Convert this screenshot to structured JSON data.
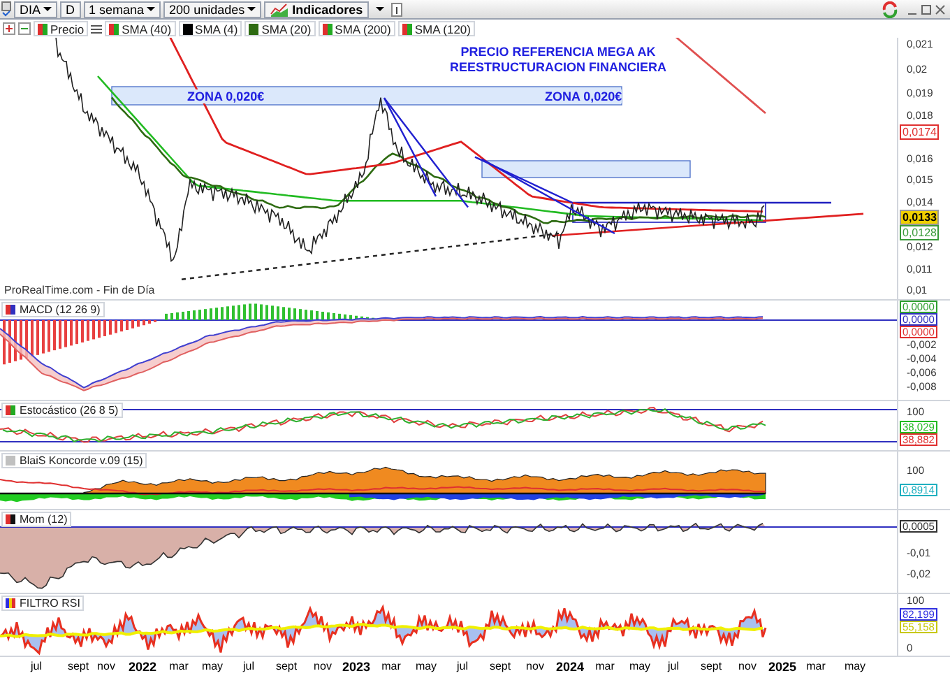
{
  "toolbar": {
    "symbol": "DIA",
    "mode": "D",
    "period": "1 semana",
    "units": "200 unidades",
    "indicators": "Indicadores"
  },
  "legend": [
    {
      "label": "Precio",
      "kind": "split"
    },
    {
      "label": "SMA (40)",
      "kind": "split"
    },
    {
      "label": "SMA (4)",
      "kind": "solid",
      "color": "#000000"
    },
    {
      "label": "SMA (20)",
      "kind": "solid",
      "color": "#2e6b12"
    },
    {
      "label": "SMA (200)",
      "kind": "split"
    },
    {
      "label": "SMA (120)",
      "kind": "split"
    }
  ],
  "main_chart": {
    "title_lines": [
      "PRECIO REFERENCIA MEGA AK",
      "REESTRUCTURACION FINANCIERA"
    ],
    "zone_labels": [
      "ZONA 0,020€",
      "ZONA 0,020€"
    ],
    "source": "ProRealTime.com - Fin de Día",
    "ticks": [
      "0,021",
      "0,02",
      "0,019",
      "0,018",
      "0,016",
      "0,015",
      "0,014",
      "0,012",
      "0,011",
      "0,01"
    ],
    "badges": [
      {
        "text": "0,0174",
        "color": "#e03030"
      },
      {
        "text": "0,0133",
        "color": "#f0d000"
      },
      {
        "text": "0,0128",
        "color": "#3a9a3a"
      }
    ]
  },
  "panels": [
    {
      "kind": "macd",
      "title": "MACD (12 26 9)",
      "ticks": [
        "-0,002",
        "-0,004",
        "-0,006",
        "-0,008"
      ],
      "badges": [
        {
          "text": "0,0000",
          "color": "#2fa02f"
        },
        {
          "text": "0,0000",
          "color": "#3030c0"
        },
        {
          "text": "0,0000",
          "color": "#e03030"
        }
      ]
    },
    {
      "kind": "stochastic",
      "title": "Estocástico (26 8 5)",
      "ticks": [
        "100"
      ],
      "badges": [
        {
          "text": "38,029",
          "color": "#22bb22"
        },
        {
          "text": "38,882",
          "color": "#e03030"
        }
      ]
    },
    {
      "kind": "koncorde",
      "title": "BlaiS Koncorde v.09 (15)",
      "ticks": [
        "100"
      ],
      "badges": [
        {
          "text": "0,8914",
          "color": "#20b0c0"
        }
      ]
    },
    {
      "kind": "momentum",
      "title": "Mom (12)",
      "ticks": [
        "-0,01",
        "-0,02"
      ],
      "badges": [
        {
          "text": "0,0005",
          "color": "#333333"
        }
      ]
    },
    {
      "kind": "rsi",
      "title": "FILTRO RSI",
      "ticks": [
        "100",
        "0"
      ],
      "badges": [
        {
          "text": "82,199",
          "color": "#3030e0"
        },
        {
          "text": "55,158",
          "color": "#c8c800"
        }
      ]
    }
  ],
  "x_axis": [
    {
      "label": "jul",
      "kind": "month"
    },
    {
      "label": "sept",
      "kind": "month"
    },
    {
      "label": "nov",
      "kind": "month"
    },
    {
      "label": "2022",
      "kind": "year"
    },
    {
      "label": "mar",
      "kind": "month"
    },
    {
      "label": "may",
      "kind": "month"
    },
    {
      "label": "jul",
      "kind": "month"
    },
    {
      "label": "sept",
      "kind": "month"
    },
    {
      "label": "nov",
      "kind": "month"
    },
    {
      "label": "2023",
      "kind": "year"
    },
    {
      "label": "mar",
      "kind": "month"
    },
    {
      "label": "may",
      "kind": "month"
    },
    {
      "label": "jul",
      "kind": "month"
    },
    {
      "label": "sept",
      "kind": "month"
    },
    {
      "label": "nov",
      "kind": "month"
    },
    {
      "label": "2024",
      "kind": "year"
    },
    {
      "label": "mar",
      "kind": "month"
    },
    {
      "label": "may",
      "kind": "month"
    },
    {
      "label": "jul",
      "kind": "month"
    },
    {
      "label": "sept",
      "kind": "month"
    },
    {
      "label": "nov",
      "kind": "month"
    },
    {
      "label": "2025",
      "kind": "year"
    },
    {
      "label": "mar",
      "kind": "month"
    },
    {
      "label": "may",
      "kind": "month"
    }
  ]
}
